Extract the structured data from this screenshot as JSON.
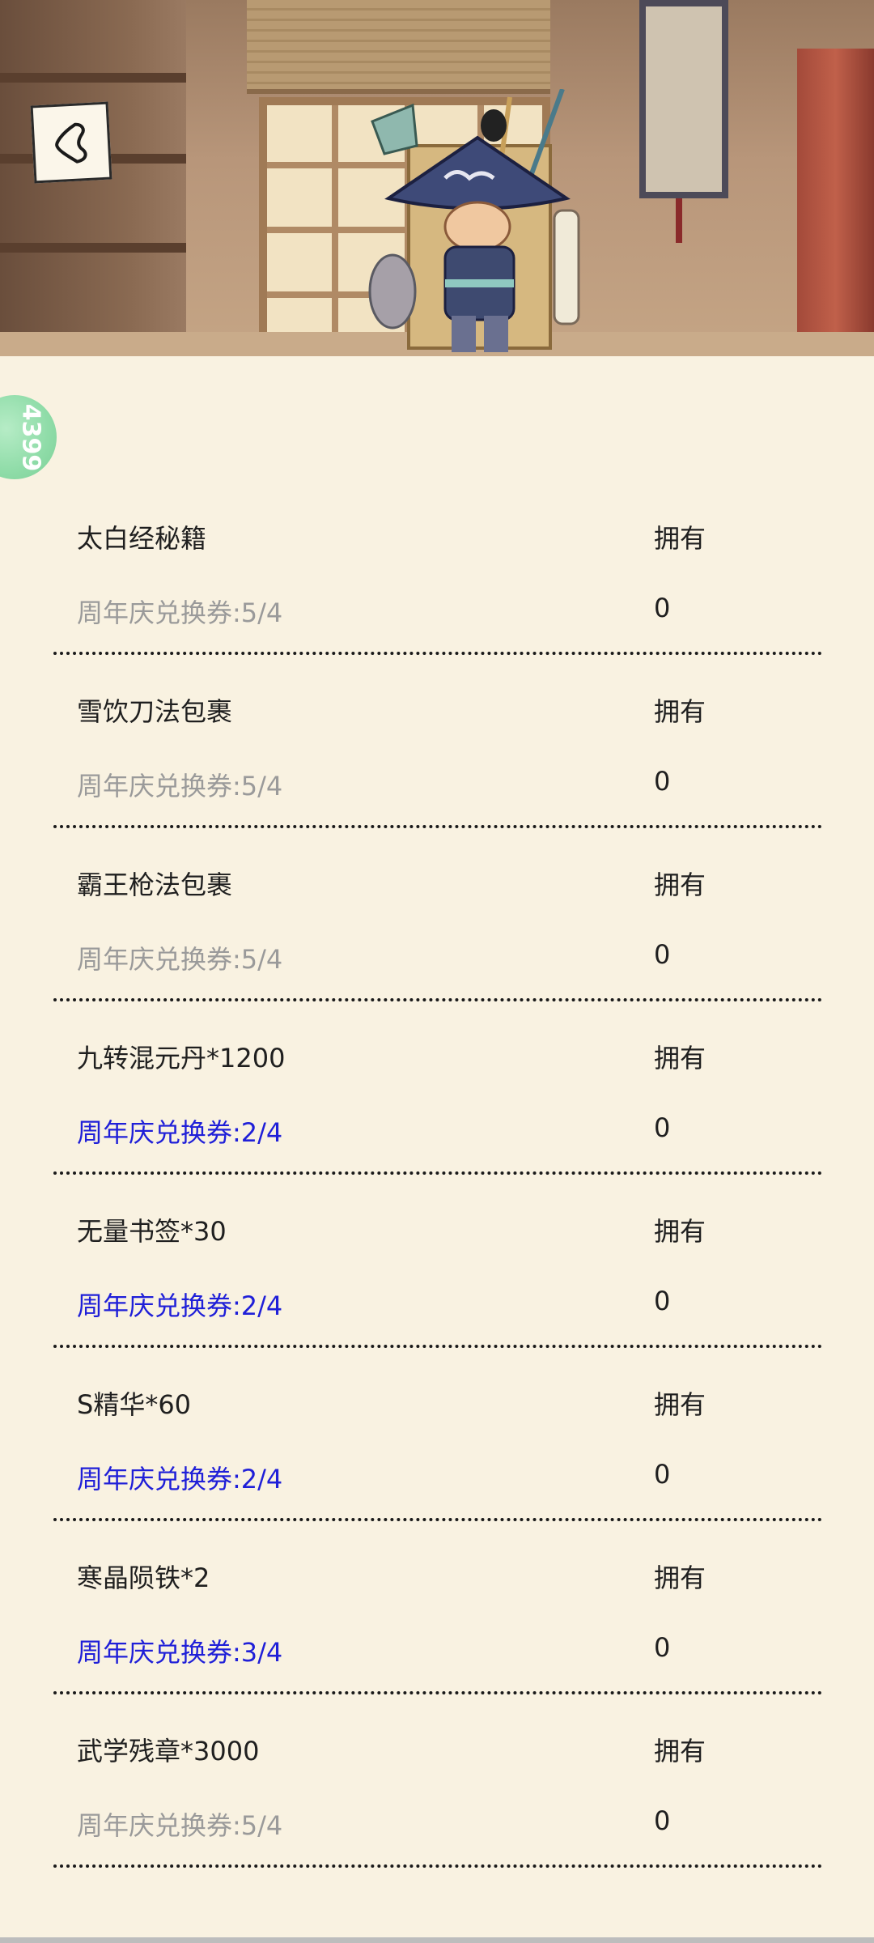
{
  "header": {
    "back_icon": "back-arrow-icon",
    "character": "wandering-merchant-illustration"
  },
  "coin_badge": {
    "text": "4399"
  },
  "colors": {
    "background": "#f9f2e1",
    "text": "#1f1f1f",
    "cost_unaffordable": "#9a9a9a",
    "cost_affordable": "#1f1fd8",
    "badge": "#8fdca8"
  },
  "items": [
    {
      "name": "太白经秘籍",
      "own_label": "拥有",
      "cost": "周年庆兑换券:5/4",
      "owned": "0",
      "affordable": false
    },
    {
      "name": "雪饮刀法包裹",
      "own_label": "拥有",
      "cost": "周年庆兑换券:5/4",
      "owned": "0",
      "affordable": false
    },
    {
      "name": "霸王枪法包裹",
      "own_label": "拥有",
      "cost": "周年庆兑换券:5/4",
      "owned": "0",
      "affordable": false
    },
    {
      "name": "九转混元丹*1200",
      "own_label": "拥有",
      "cost": "周年庆兑换券:2/4",
      "owned": "0",
      "affordable": true
    },
    {
      "name": "无量书签*30",
      "own_label": "拥有",
      "cost": "周年庆兑换券:2/4",
      "owned": "0",
      "affordable": true
    },
    {
      "name": "S精华*60",
      "own_label": "拥有",
      "cost": "周年庆兑换券:2/4",
      "owned": "0",
      "affordable": true
    },
    {
      "name": "寒晶陨铁*2",
      "own_label": "拥有",
      "cost": "周年庆兑换券:3/4",
      "owned": "0",
      "affordable": true
    },
    {
      "name": "武学残章*3000",
      "own_label": "拥有",
      "cost": "周年庆兑换券:5/4",
      "owned": "0",
      "affordable": false
    }
  ]
}
